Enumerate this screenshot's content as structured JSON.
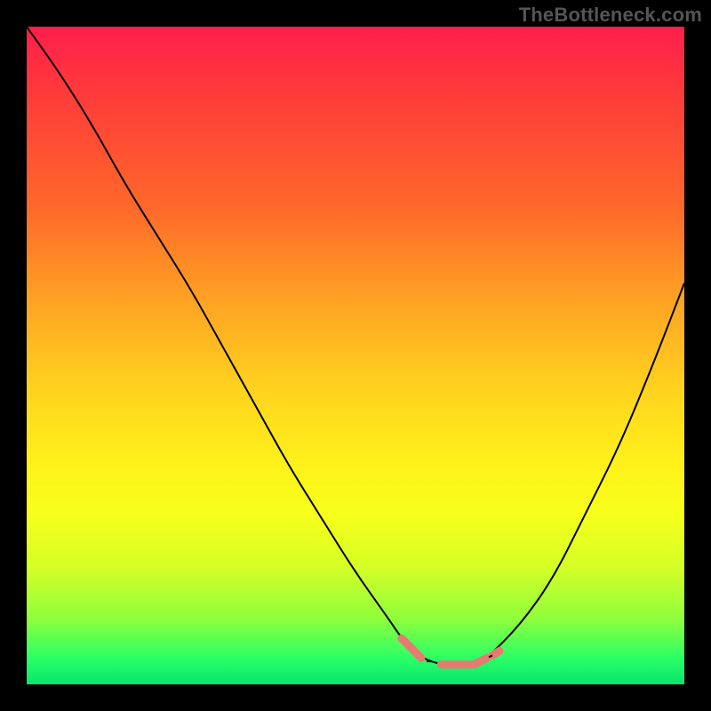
{
  "watermark": "TheBottleneck.com",
  "colors": {
    "background": "#000000",
    "accent_stroke": "#e77a71",
    "curve_stroke": "#000000",
    "gradient_top": "#ff1e4c",
    "gradient_bottom": "#07e56b",
    "watermark_text": "#555555"
  },
  "chart_data": {
    "type": "line",
    "title": "",
    "xlabel": "",
    "ylabel": "",
    "xlim": [
      0,
      100
    ],
    "ylim": [
      0,
      100
    ],
    "grid": false,
    "legend": false,
    "series": [
      {
        "name": "bottleneck-curve",
        "x": [
          0,
          5,
          10,
          15,
          20,
          25,
          30,
          35,
          40,
          45,
          50,
          55,
          57,
          60,
          63,
          65,
          68,
          70,
          75,
          80,
          85,
          90,
          95,
          100
        ],
        "y": [
          100,
          93,
          85,
          76,
          68,
          60,
          51,
          42,
          33,
          25,
          17,
          10,
          7,
          4,
          3,
          3,
          3,
          4,
          9,
          16,
          26,
          36,
          48,
          61
        ]
      }
    ],
    "accent_region": {
      "name": "flat-bottom-highlight",
      "x": [
        57,
        60,
        63,
        65,
        68,
        70
      ],
      "y": [
        7,
        4,
        3,
        3,
        3,
        4
      ],
      "gap_after_index": 0,
      "end_right_dash": true
    }
  }
}
